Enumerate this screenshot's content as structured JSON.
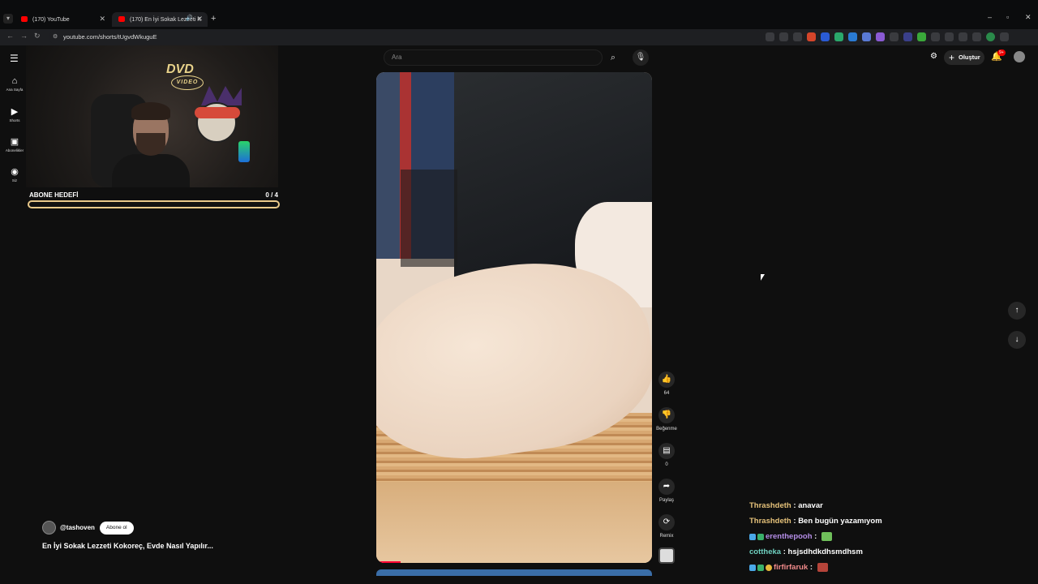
{
  "browser": {
    "tabs": [
      {
        "title": "(170) YouTube",
        "active": false
      },
      {
        "title": "(170) En İyi Sokak Lezzeti K",
        "active": true
      }
    ],
    "url": "youtube.com/shorts/tUgvdWkuguE",
    "new_tab": "+",
    "window_controls": [
      "–",
      "▫",
      "✕"
    ]
  },
  "sidebar": {
    "items": [
      {
        "label": "Ana Sayfa",
        "icon": "home-icon",
        "glyph": "⌂"
      },
      {
        "label": "Shorts",
        "icon": "shorts-icon",
        "glyph": "▶"
      },
      {
        "label": "Abonelikler",
        "icon": "subscriptions-icon",
        "glyph": "▣"
      },
      {
        "label": "Siz",
        "icon": "you-icon",
        "glyph": "◉"
      }
    ]
  },
  "header": {
    "search_placeholder": "Ara",
    "create_label": "Oluştur",
    "notifications_badge": "9+"
  },
  "overlay": {
    "dvd_text": "DVD",
    "dvd_sub": "VIDEO",
    "goal_title": "ABONE HEDEFİ",
    "goal_count": "0  / 4",
    "goal_progress": 0.0
  },
  "short": {
    "channel": "@tashoven",
    "subscribe_label": "Abone ol",
    "title": "En İyi Sokak Lezzeti Kokoreç, Evde Nasıl Yapılır...",
    "likes": "64",
    "dislike_label": "Beğenme",
    "comments": "0",
    "share_label": "Paylaş",
    "remix_label": "Remix"
  },
  "chat": [
    {
      "user": "Thrashdeth",
      "msg": "anavar",
      "color": "#e6c27a",
      "emote": false,
      "icons": false
    },
    {
      "user": "Thrashdeth",
      "msg": "Ben bugün yazamıyom",
      "color": "#e6c27a",
      "emote": false,
      "icons": false
    },
    {
      "user": "erenthepooh",
      "msg": "",
      "color": "#b58ee8",
      "emote": true,
      "icons": true
    },
    {
      "user": "cottheka",
      "msg": "hsjsdhdkdhsmdhsm",
      "color": "#6fd1c0",
      "emote": false,
      "icons": false
    },
    {
      "user": "firfirfaruk",
      "msg": "",
      "color": "#f28b8b",
      "emote": true,
      "icons": true
    }
  ]
}
